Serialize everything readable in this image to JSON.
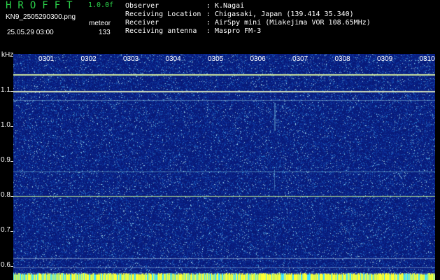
{
  "header": {
    "app_title": "HROFFT",
    "version": "1.0.0f",
    "file_name": "KN9_2505290300.png",
    "obs_type": "meteor",
    "timestamp": "25.05.29 03:00",
    "count": "133"
  },
  "info": [
    {
      "label": "Observer",
      "value": "K.Nagai"
    },
    {
      "label": "Receiving Location",
      "value": "Chigasaki, Japan (139.414 35.340)"
    },
    {
      "label": "Receiver",
      "value": "AirSpy mini (Miakejima VOR 108.65MHz)"
    },
    {
      "label": "Receiving antenna",
      "value": "Maspro FM-3"
    }
  ],
  "axes": {
    "y_unit": "kHz",
    "y_ticks": [
      {
        "label": "1.1",
        "value": 1.1
      },
      {
        "label": "1.0",
        "value": 1.0
      },
      {
        "label": "0.9",
        "value": 0.9
      },
      {
        "label": "0.8",
        "value": 0.8
      },
      {
        "label": "0.7",
        "value": 0.7
      },
      {
        "label": "0.6",
        "value": 0.6
      }
    ],
    "hour_labels": [
      "0301",
      "0302",
      "0303",
      "0304",
      "0305",
      "0306",
      "0307",
      "0308",
      "0309",
      "0310"
    ]
  },
  "colors": {
    "title_green": "#2bd24a",
    "background": "#081a78",
    "signal_line": "#c8e8a8"
  }
}
